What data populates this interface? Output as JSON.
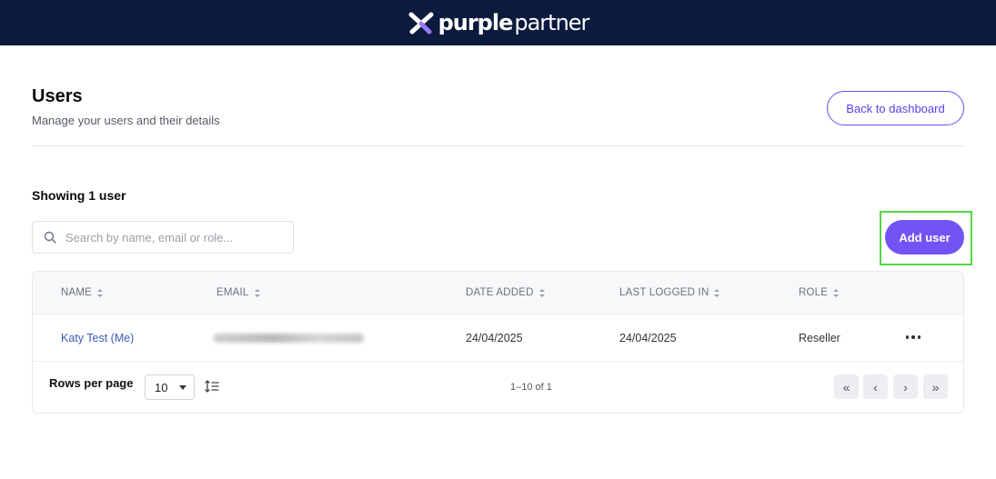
{
  "header": {
    "brand_bold": "purple",
    "brand_light": "partner",
    "bg_color": "#0c1a3d"
  },
  "page": {
    "title": "Users",
    "subtitle": "Manage your users and their details",
    "back_button": "Back to dashboard"
  },
  "listing": {
    "showing": "Showing 1 user",
    "search_placeholder": "Search by name, email or role...",
    "add_button": "Add user",
    "accent_color": "#7254f5"
  },
  "table": {
    "columns": [
      "NAME",
      "EMAIL",
      "DATE ADDED",
      "LAST LOGGED IN",
      "ROLE"
    ],
    "rows": [
      {
        "name": "Katy Test (Me)",
        "email": "[redacted]",
        "date_added": "24/04/2025",
        "last_logged_in": "24/04/2025",
        "role": "Reseller"
      }
    ]
  },
  "footer": {
    "rows_per_page_label": "Rows per page",
    "rows_per_page_value": "10",
    "range": "1–10 of 1",
    "first": "«",
    "prev": "‹",
    "next": "›",
    "last": "»"
  },
  "icons": [
    "logo-icon",
    "search-icon",
    "sort-icon",
    "more-horizontal-icon",
    "chevron-down-icon",
    "list-sort-icon",
    "first-page-icon",
    "prev-page-icon",
    "next-page-icon",
    "last-page-icon"
  ]
}
